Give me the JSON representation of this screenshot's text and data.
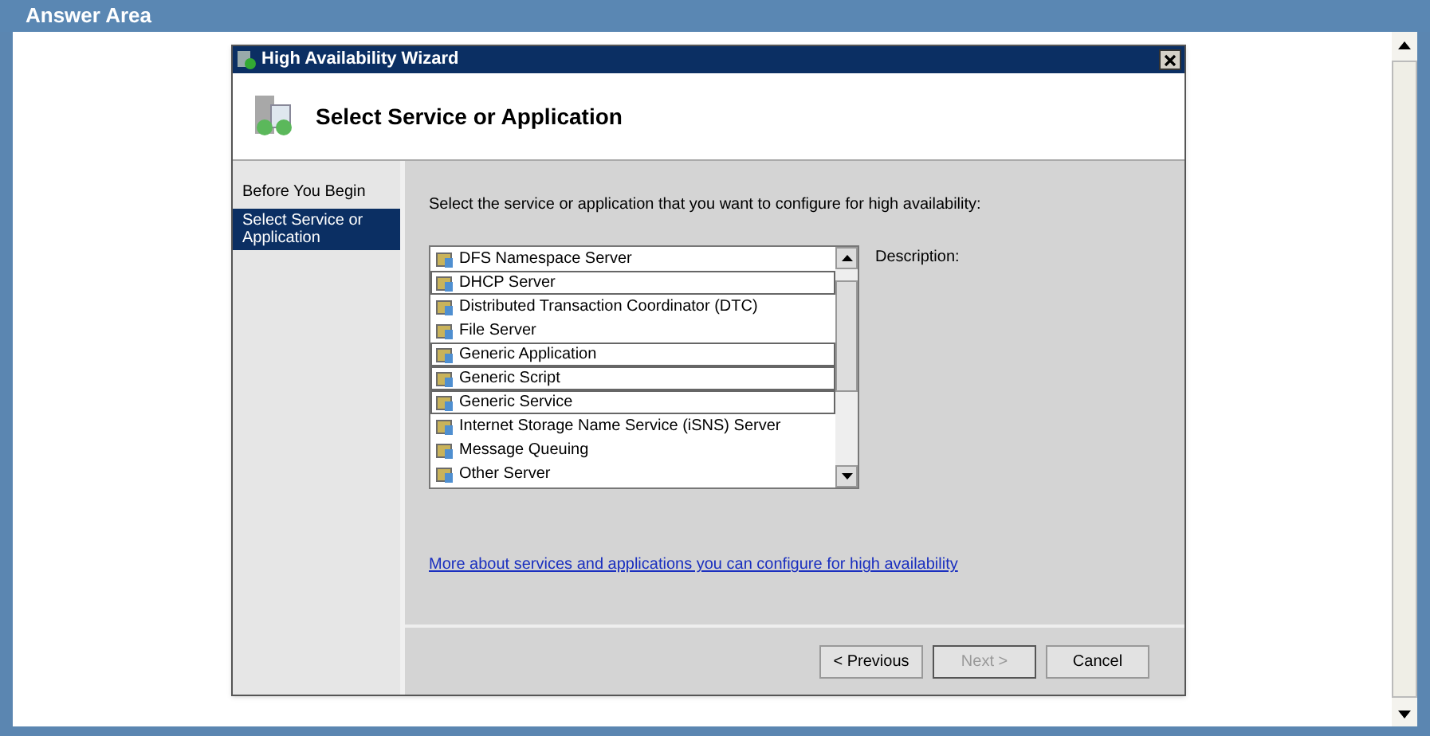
{
  "page": {
    "title": "Answer Area"
  },
  "wizard": {
    "title": "High Availability Wizard",
    "heading": "Select Service or Application",
    "steps": [
      {
        "label": "Before You Begin",
        "selected": false
      },
      {
        "label": "Select Service or Application",
        "selected": true
      }
    ],
    "instruction": "Select the service or application that you want to configure for high availability:",
    "description_label": "Description:",
    "items": [
      {
        "label": "DFS Namespace Server",
        "outlined": false
      },
      {
        "label": "DHCP Server",
        "outlined": true
      },
      {
        "label": "Distributed Transaction Coordinator (DTC)",
        "outlined": false
      },
      {
        "label": "File Server",
        "outlined": false
      },
      {
        "label": "Generic Application",
        "outlined": true
      },
      {
        "label": "Generic Script",
        "outlined": true
      },
      {
        "label": "Generic Service",
        "outlined": true
      },
      {
        "label": "Internet Storage Name Service (iSNS) Server",
        "outlined": false
      },
      {
        "label": "Message Queuing",
        "outlined": false
      },
      {
        "label": "Other Server",
        "outlined": false
      }
    ],
    "link": "More about services and applications you can configure for high availability",
    "buttons": [
      {
        "label": "< Previous",
        "disabled": false
      },
      {
        "label": "Next >",
        "disabled": true
      },
      {
        "label": "Cancel",
        "disabled": false
      }
    ]
  }
}
